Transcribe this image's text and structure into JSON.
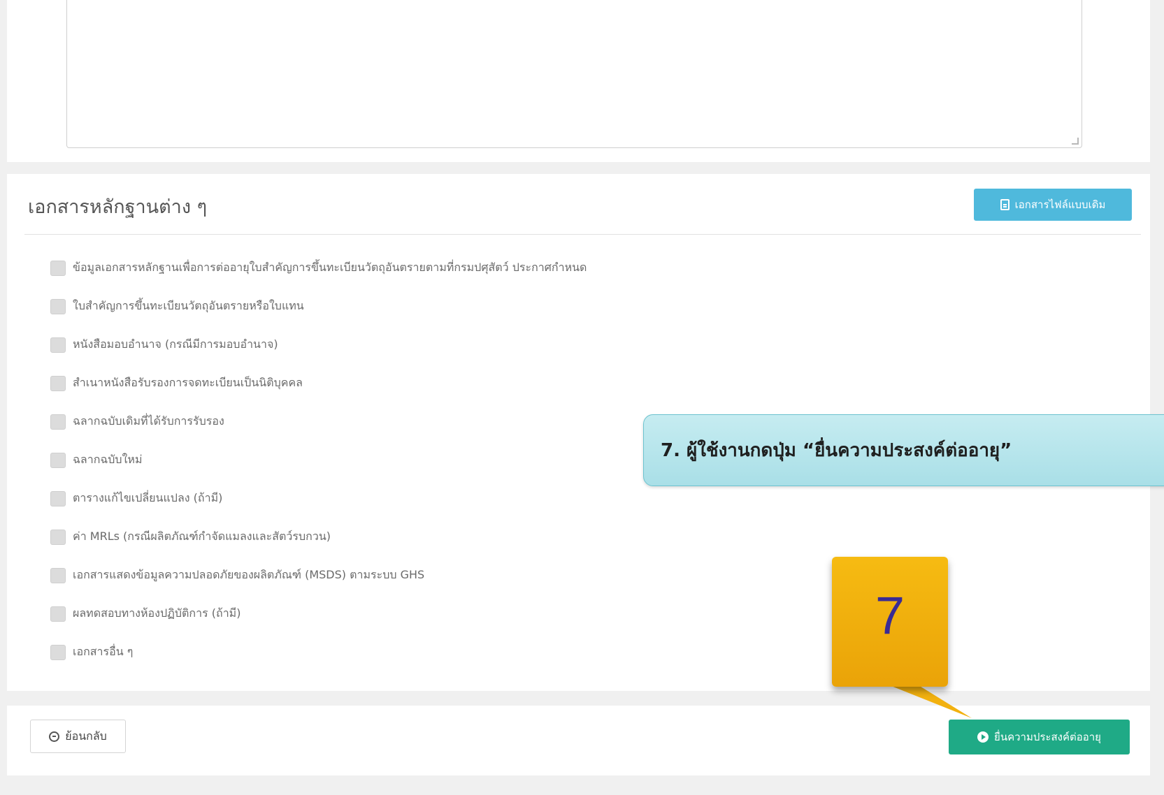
{
  "documents": {
    "title": "เอกสารหลักฐานต่าง ๆ",
    "file_button_label": "เอกสารไฟล์แบบเดิม",
    "items": [
      "ข้อมูลเอกสารหลักฐานเพื่อการต่ออายุใบสำคัญการขึ้นทะเบียนวัตถุอันตรายตามที่กรมปศุสัตว์ ประกาศกำหนด",
      "ใบสำคัญการขึ้นทะเบียนวัตถุอันตรายหรือใบแทน",
      "หนังสือมอบอำนาจ (กรณีมีการมอบอำนาจ)",
      "สำเนาหนังสือรับรองการจดทะเบียนเป็นนิติบุคคล",
      "ฉลากฉบับเดิมที่ได้รับการรับรอง",
      "ฉลากฉบับใหม่",
      "ตารางแก้ไขเปลี่ยนแปลง (ถ้ามี)",
      "ค่า MRLs (กรณีผลิตภัณฑ์กำจัดแมลงและสัตว์รบกวน)",
      "เอกสารแสดงข้อมูลความปลอดภัยของผลิตภัณฑ์ (MSDS) ตามระบบ GHS",
      "ผลทดสอบทางห้องปฏิบัติการ (ถ้ามี)",
      "เอกสารอื่น ๆ"
    ]
  },
  "footer": {
    "back_label": "ย้อนกลับ",
    "submit_label": "ยื่นความประสงค์ต่ออายุ"
  },
  "annotation": {
    "callout_text": "7. ผู้ใช้งานกดปุ่ม “ยื่นความประสงค์ต่ออายุ”",
    "step_number": "7"
  },
  "colors": {
    "info_button": "#4fb9dc",
    "submit_button": "#1faa86",
    "marker": "#f2b10f",
    "callout": "#b8e6ec"
  }
}
